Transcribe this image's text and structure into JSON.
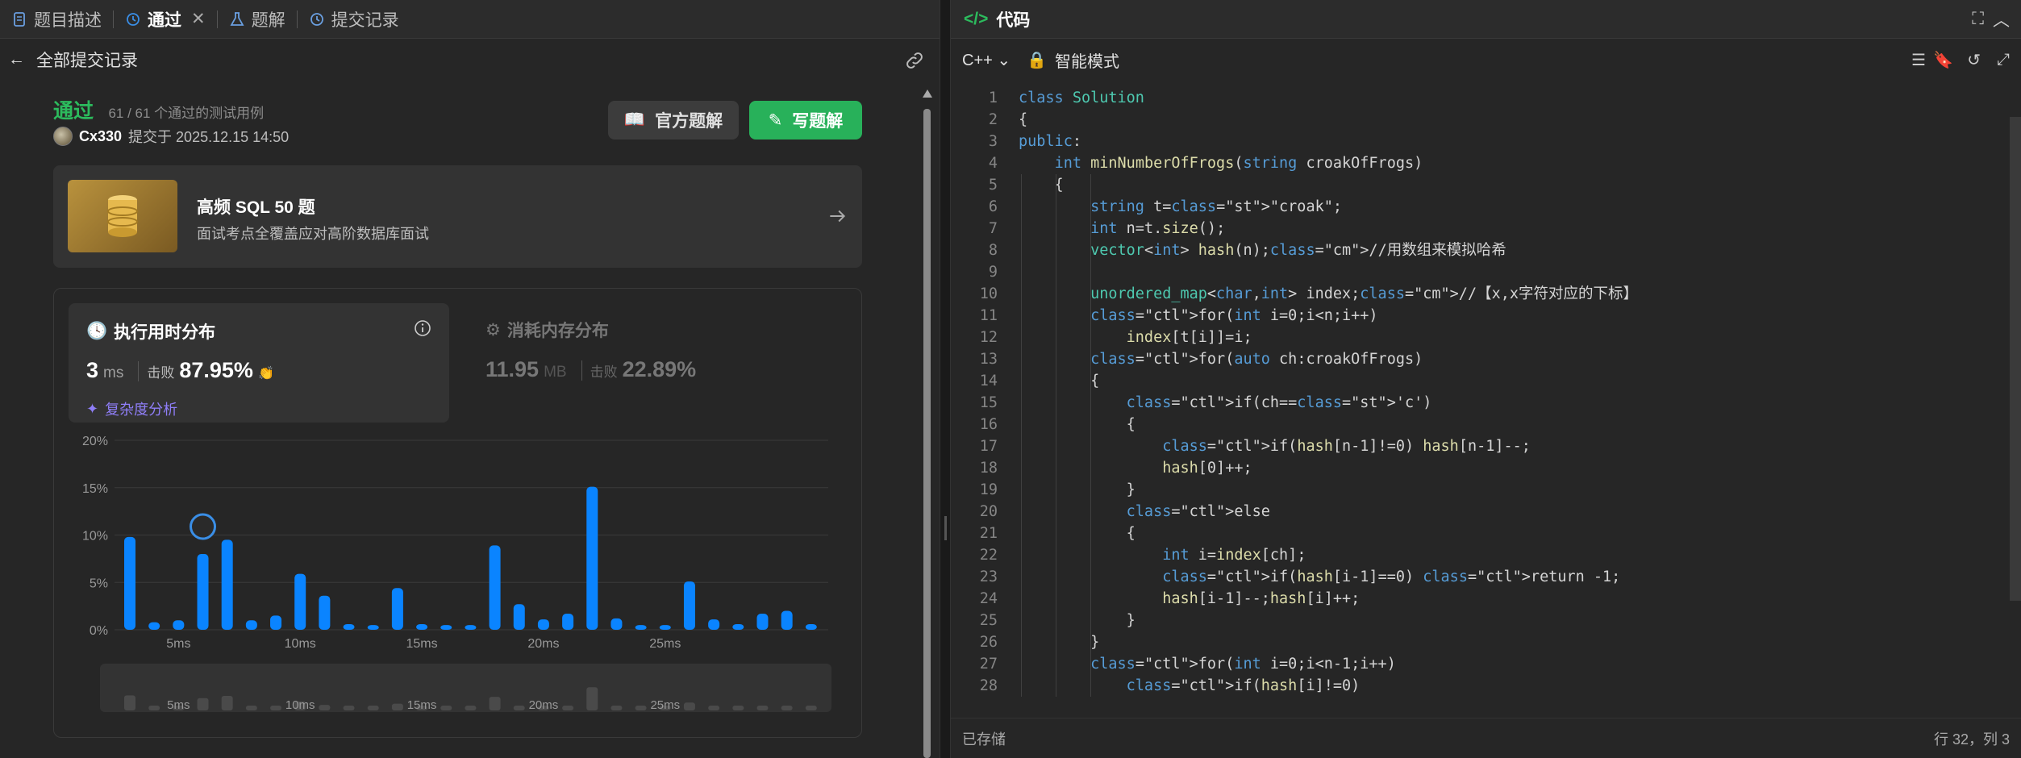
{
  "left_tabs": [
    "题目描述",
    "通过",
    "题解",
    "提交记录"
  ],
  "subbar": {
    "back_label": "全部提交记录"
  },
  "result": {
    "status": "通过",
    "cases": "61 / 61 个通过的测试用例",
    "user": "Cx330",
    "submitted_at": "提交于 2025.12.15 14:50"
  },
  "buttons": {
    "official": "官方题解",
    "write": "写题解"
  },
  "banner": {
    "title": "高频 SQL 50 题",
    "subtitle": "面试考点全覆盖应对高阶数据库面试"
  },
  "runtime": {
    "title": "执行用时分布",
    "value": "3",
    "unit": "ms",
    "beat_label": "击败",
    "beat": "87.95%",
    "complexity": "复杂度分析"
  },
  "memory": {
    "title": "消耗内存分布",
    "value": "11.95",
    "unit": "MB",
    "beat_label": "击败",
    "beat": "22.89%"
  },
  "chart_data": {
    "type": "bar",
    "y_ticks": [
      "20%",
      "15%",
      "10%",
      "5%",
      "0%"
    ],
    "x_ticks": [
      "5ms",
      "10ms",
      "15ms",
      "20ms",
      "25ms"
    ],
    "ylim": [
      0,
      20
    ],
    "values": [
      9.8,
      0.8,
      1.0,
      8.0,
      9.5,
      1.0,
      1.5,
      5.9,
      3.6,
      0.6,
      0.5,
      4.4,
      0.6,
      0.5,
      0.5,
      8.9,
      2.7,
      1.1,
      1.7,
      15.1,
      1.2,
      0.5,
      0.5,
      5.1,
      1.1,
      0.6,
      1.7,
      2.0,
      0.6
    ],
    "highlight_index": 3,
    "colors": {
      "bar": "#0a84ff",
      "grid": "#3a3a3a"
    }
  },
  "editor": {
    "title": "代码",
    "language": "C++",
    "mode": "智能模式",
    "saved": "已存储",
    "cursor": "行 32，列 3"
  },
  "code_lines": [
    "class Solution",
    "{",
    "public:",
    "    int minNumberOfFrogs(string croakOfFrogs)",
    "    {",
    "        string t=\"croak\";",
    "        int n=t.size();",
    "        vector<int> hash(n);//用数组来模拟哈希",
    "",
    "        unordered_map<char,int> index;//【x,x字符对应的下标】",
    "        for(int i=0;i<n;i++)",
    "            index[t[i]]=i;",
    "        for(auto ch:croakOfFrogs)",
    "        {",
    "            if(ch=='c')",
    "            {",
    "                if(hash[n-1]!=0) hash[n-1]--;",
    "                hash[0]++;",
    "            }",
    "            else",
    "            {",
    "                int i=index[ch];",
    "                if(hash[i-1]==0) return -1;",
    "                hash[i-1]--;hash[i]++;",
    "            }",
    "        }",
    "        for(int i=0;i<n-1;i++)",
    "            if(hash[i]!=0)"
  ]
}
